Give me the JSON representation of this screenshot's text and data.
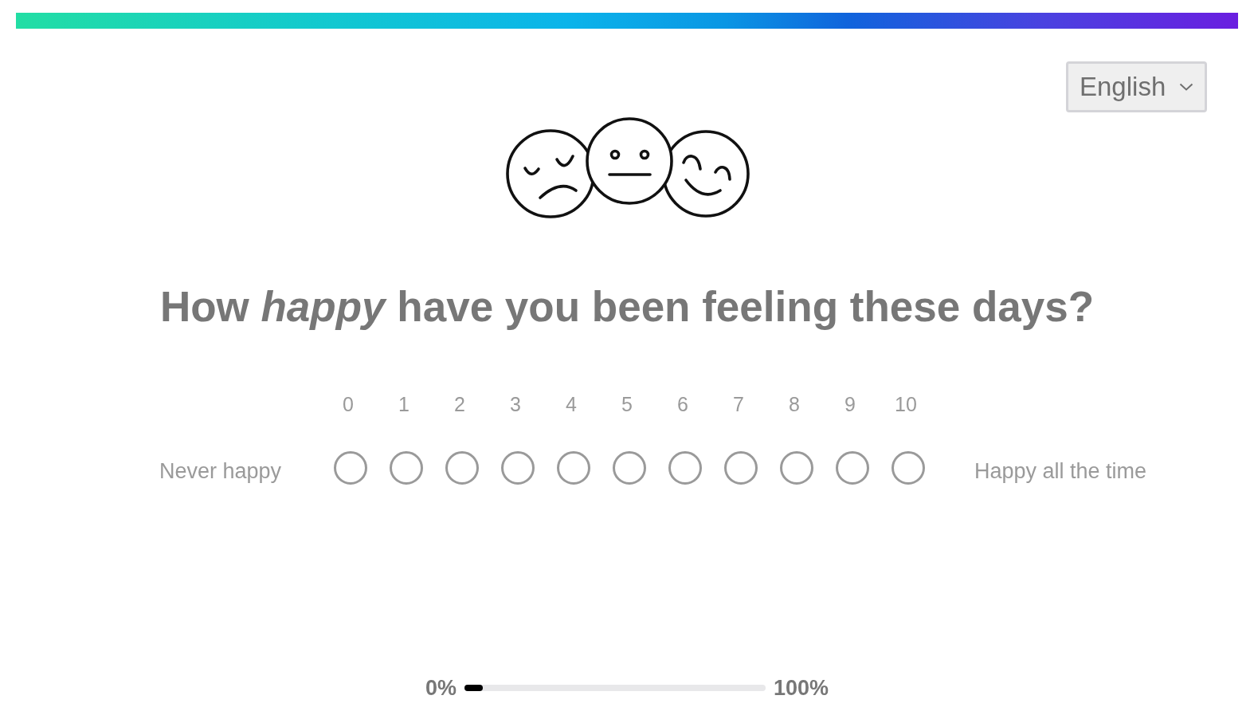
{
  "language_select": {
    "value": "English"
  },
  "question": {
    "text": "How *happy* have you been feeling these days?"
  },
  "scale": {
    "min_label": "Never happy",
    "max_label": "Happy all the time",
    "options": [
      {
        "label": "0",
        "selected": false
      },
      {
        "label": "1",
        "selected": false
      },
      {
        "label": "2",
        "selected": false
      },
      {
        "label": "3",
        "selected": false
      },
      {
        "label": "4",
        "selected": false
      },
      {
        "label": "5",
        "selected": false
      },
      {
        "label": "6",
        "selected": false
      },
      {
        "label": "7",
        "selected": false
      },
      {
        "label": "8",
        "selected": false
      },
      {
        "label": "9",
        "selected": false
      },
      {
        "label": "10",
        "selected": false
      }
    ]
  },
  "progress": {
    "start_label": "0%",
    "end_label": "100%",
    "level": 0.06
  }
}
